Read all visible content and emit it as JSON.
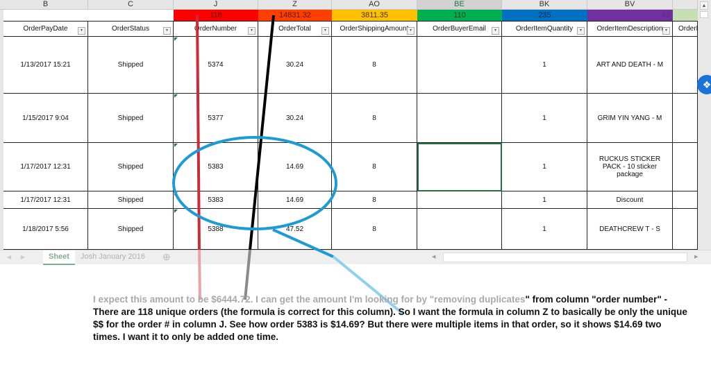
{
  "columns": [
    {
      "letter": "B",
      "header": "OrderPayDate",
      "summary": "",
      "summary_color": "#ffffff"
    },
    {
      "letter": "C",
      "header": "OrderStatus",
      "summary": "",
      "summary_color": "#ffffff"
    },
    {
      "letter": "J",
      "header": "OrderNumber",
      "summary": "118",
      "summary_color": "#ff0000"
    },
    {
      "letter": "Z",
      "header": "OrderTotal",
      "summary": "14831.32",
      "summary_color": "#ff3f00"
    },
    {
      "letter": "AO",
      "header": "OrderShippingAmount",
      "summary": "3811.35",
      "summary_color": "#ffc000"
    },
    {
      "letter": "BE",
      "header": "OrderBuyerEmail",
      "summary": "110",
      "summary_color": "#00b050"
    },
    {
      "letter": "BK",
      "header": "OrderItemQuantity",
      "summary": "235",
      "summary_color": "#0070c0"
    },
    {
      "letter": "BV",
      "header": "OrderItemDescription",
      "summary": "43",
      "summary_color": "#7030a0"
    },
    {
      "letter": "",
      "header": "OrderIte",
      "summary": "",
      "summary_color": "#c6e0b4"
    }
  ],
  "rows": [
    [
      "1/13/2017 15:21",
      "Shipped",
      "5374",
      "30.24",
      "8",
      "",
      "1",
      "ART AND DEATH - M",
      ""
    ],
    [
      "1/15/2017 9:04",
      "Shipped",
      "5377",
      "30.24",
      "8",
      "",
      "1",
      "GRIM YIN YANG - M",
      ""
    ],
    [
      "1/17/2017 12:31",
      "Shipped",
      "5383",
      "14.69",
      "8",
      "",
      "1",
      "RUCKUS STICKER PACK - 10 sticker package",
      ""
    ],
    [
      "1/17/2017 12:31",
      "Shipped",
      "5383",
      "14.69",
      "8",
      "",
      "1",
      "Discount",
      ""
    ],
    [
      "1/18/2017 5:56",
      "Shipped",
      "5388",
      "47.52",
      "8",
      "",
      "1",
      "DEATHCREW T - S",
      ""
    ]
  ],
  "filter_glyph": "▾",
  "sheet_tabs": [
    {
      "label": "Sheet",
      "active": true
    },
    {
      "label": "Josh January 2016",
      "active": false
    }
  ],
  "add_sheet_glyph": "⊕",
  "nav_left_glyph": "◀",
  "nav_right_glyph": "▶",
  "scroll_up_glyph": "▲",
  "scroll_down_glyph": "▼",
  "dropbox_icon": "❖",
  "note": {
    "gray_part1": "I expect this amount to be $6444.72. I can get the amount I'm looking for by \"removing duplicates",
    "black_part": "\" from column \"order number\" - There are 118 unique orders (the formula is correct for this column). So I want the formula in column Z to basically be only the unique $$ for the order # in column J. See how order 5383 is $14.69? But there were multiple items in that order, so it shows $14.69 two times. I want it to only be added one time."
  },
  "annotation_colors": {
    "red_line": "#cc2a36",
    "black_line": "#000000",
    "circle": "#1e9bd7"
  }
}
